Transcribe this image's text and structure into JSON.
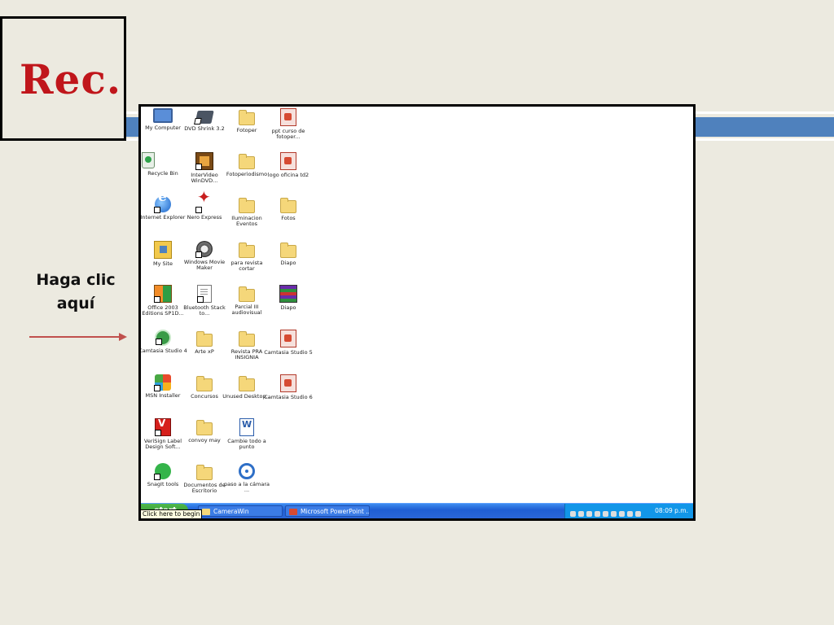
{
  "slide": {
    "title": "Rec.",
    "hint_line1": "Haga clic",
    "hint_line2": "aquí",
    "colors": {
      "title": "#C0161B",
      "red_block": "#C0504D",
      "blue_band": "#4F81BD",
      "background": "#ECEAE0"
    }
  },
  "desktop": {
    "icons": [
      {
        "label": "My Computer",
        "icon": "monitor-icon"
      },
      {
        "label": "Recycle Bin",
        "icon": "recycle-bin-icon"
      },
      {
        "label": "Internet Explorer",
        "icon": "internet-explorer-icon"
      },
      {
        "label": "My Site",
        "icon": "my-site-icon"
      },
      {
        "label": "Office 2003 Editions SP1D...",
        "icon": "office-icon"
      },
      {
        "label": "Camtasia Studio 4",
        "icon": "camtasia-icon"
      },
      {
        "label": "MSN Installer",
        "icon": "msn-icon"
      },
      {
        "label": "VeriSign Label Design Soft...",
        "icon": "label-design-icon"
      },
      {
        "label": "SnagIt tools",
        "icon": "snagit-icon"
      },
      {
        "label": "DVD Shrink 3.2",
        "icon": "dvd-shrink-icon"
      },
      {
        "label": "InterVideo WinDVD...",
        "icon": "intervideo-icon"
      },
      {
        "label": "Nero Express",
        "icon": "nero-icon"
      },
      {
        "label": "Windows Movie Maker",
        "icon": "movie-maker-icon"
      },
      {
        "label": "Bluetooth Stack to...",
        "icon": "document-icon"
      },
      {
        "label": "Arte xP",
        "icon": "folder-icon"
      },
      {
        "label": "Concursos",
        "icon": "folder-icon"
      },
      {
        "label": "convoy may",
        "icon": "folder-icon"
      },
      {
        "label": "Documentos de Escritorio",
        "icon": "folder-icon"
      },
      {
        "label": "Fotoper",
        "icon": "folder-icon"
      },
      {
        "label": "Fotoperiodismo",
        "icon": "folder-icon"
      },
      {
        "label": "Iluminacion Eventos",
        "icon": "folder-icon"
      },
      {
        "label": "para revista cortar",
        "icon": "folder-icon"
      },
      {
        "label": "Parcial III audiovisual",
        "icon": "folder-icon"
      },
      {
        "label": "Revista PRA INSIGNIA",
        "icon": "folder-icon"
      },
      {
        "label": "Unused Desktop...",
        "icon": "folder-icon"
      },
      {
        "label": "Cambie todo a punto",
        "icon": "word-document-icon"
      },
      {
        "label": "paso a la cámara ...",
        "icon": "camera-icon"
      },
      {
        "label": "ppt curso de fotoper...",
        "icon": "powerpoint-icon"
      },
      {
        "label": "logo oficina td2",
        "icon": "powerpoint-icon"
      },
      {
        "label": "Fotos",
        "icon": "folder-icon"
      },
      {
        "label": "Diapo",
        "icon": "folder-icon"
      },
      {
        "label": "Diapo",
        "icon": "winrar-icon"
      },
      {
        "label": "Camtasia Studio 5",
        "icon": "powerpoint-icon"
      },
      {
        "label": "Camtasia Studio 6",
        "icon": "powerpoint-icon"
      }
    ]
  },
  "taskbar": {
    "start_label": "start",
    "tooltip": "Click here to begin",
    "tasks": [
      {
        "label": "CameraWin"
      },
      {
        "label": "Microsoft PowerPoint ..."
      }
    ],
    "clock": "08:09 p.m."
  }
}
